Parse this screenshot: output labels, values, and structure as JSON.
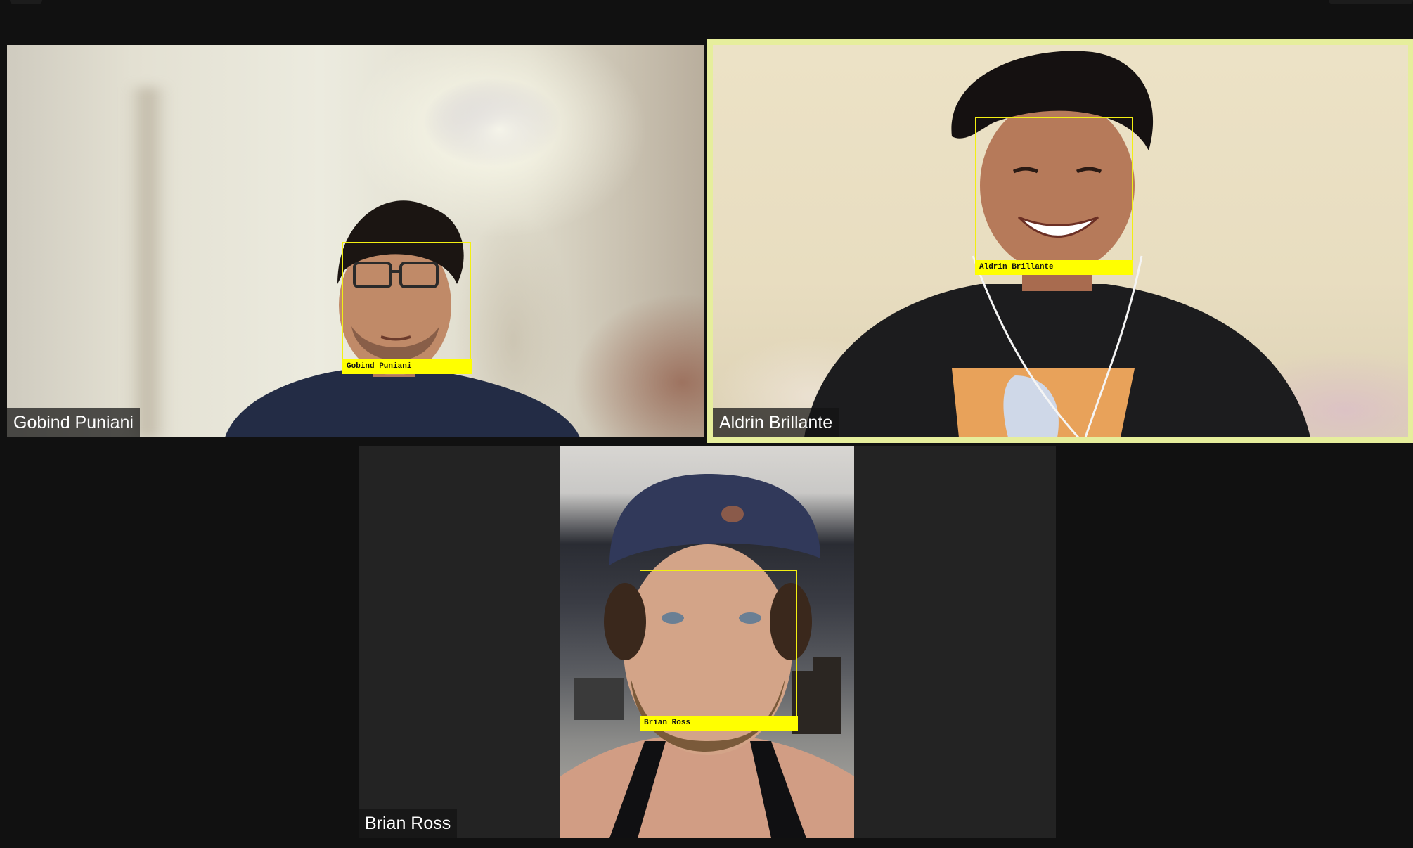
{
  "window": {
    "layout": "gallery-view"
  },
  "participants": [
    {
      "name": "Gobind Puniani",
      "face_label": "Gobind Puniani",
      "active_speaker": false
    },
    {
      "name": "Aldrin Brillante",
      "face_label": "Aldrin Brillante",
      "active_speaker": true
    },
    {
      "name": "Brian Ross",
      "face_label": "Brian Ross",
      "active_speaker": false
    }
  ],
  "colors": {
    "background": "#111111",
    "tile_background": "#232323",
    "active_speaker_border": "#e6ee9c",
    "face_box": "#f2ef12",
    "face_label_bg": "#ffff00",
    "name_tag_text": "#ffffff"
  }
}
